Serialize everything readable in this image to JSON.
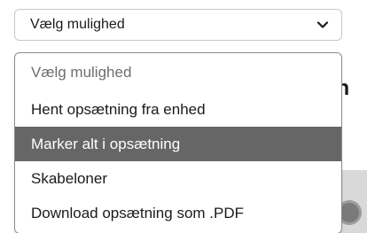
{
  "background": {
    "heading_fragment": "en"
  },
  "select": {
    "value": "Vælg mulighed",
    "icon": "chevron-down-icon"
  },
  "dropdown": {
    "options": [
      {
        "label": "Vælg mulighed",
        "state": "placeholder"
      },
      {
        "label": "Hent opsætning fra enhed",
        "state": "normal"
      },
      {
        "label": "Marker alt i opsætning",
        "state": "highlighted"
      },
      {
        "label": "Skabeloner",
        "state": "normal"
      },
      {
        "label": "Download opsætning som .PDF",
        "state": "normal"
      }
    ]
  },
  "colors": {
    "highlight_bg": "#666666",
    "highlight_text": "#ffffff",
    "placeholder_text": "#6e6e6e"
  }
}
